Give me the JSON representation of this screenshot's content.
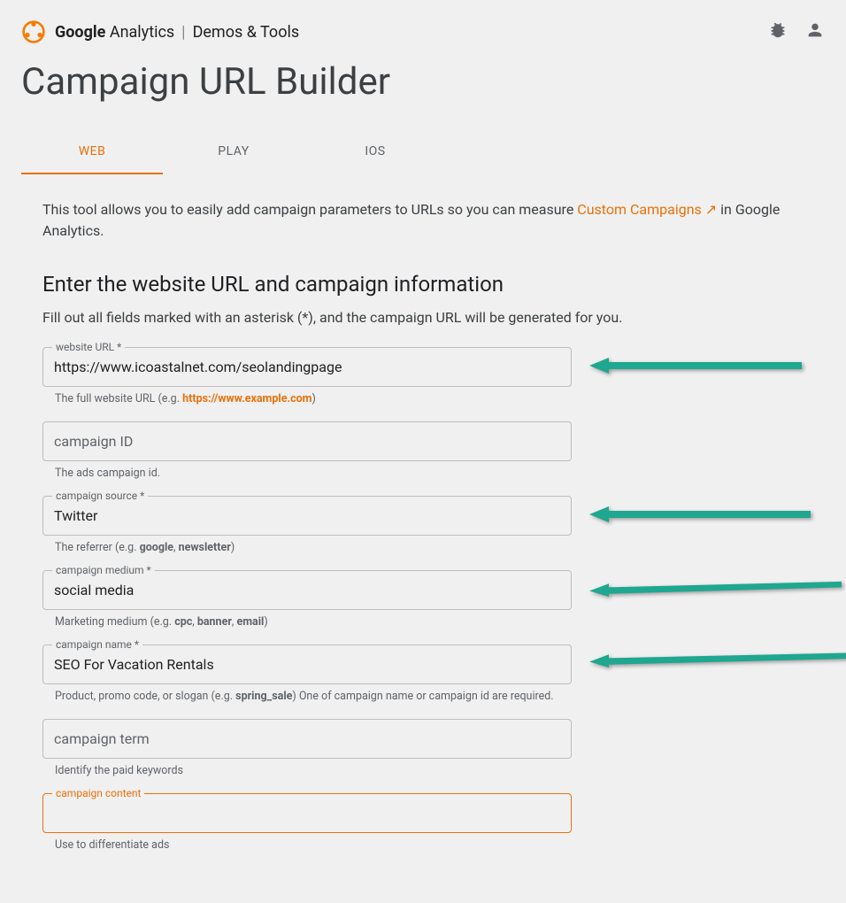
{
  "header": {
    "brand_bold": "Google",
    "brand_light": " Analytics",
    "divider": "|",
    "section": "Demos & Tools"
  },
  "page_title": "Campaign URL Builder",
  "tabs": {
    "web": "WEB",
    "play": "PLAY",
    "ios": "IOS"
  },
  "intro": {
    "part1": "This tool allows you to easily add campaign parameters to URLs so you can measure ",
    "link": "Custom Campaigns",
    "part2": " in Google Analytics."
  },
  "section_heading": "Enter the website URL and campaign information",
  "section_sub": "Fill out all fields marked with an asterisk (*), and the campaign URL will be generated for you.",
  "fields": {
    "website_url": {
      "label": "website URL *",
      "value": "https://www.icoastalnet.com/seolandingpage",
      "helper_pre": "The full website URL (e.g. ",
      "helper_link": "https://www.example.com",
      "helper_post": ")"
    },
    "campaign_id": {
      "placeholder": "campaign ID",
      "helper": "The ads campaign id."
    },
    "campaign_source": {
      "label": "campaign source *",
      "value": "Twitter",
      "helper_pre": "The referrer (e.g. ",
      "helper_b1": "google",
      "helper_mid": ", ",
      "helper_b2": "newsletter",
      "helper_post": ")"
    },
    "campaign_medium": {
      "label": "campaign medium *",
      "value": "social media",
      "helper_pre": "Marketing medium (e.g. ",
      "helper_b1": "cpc",
      "helper_m1": ", ",
      "helper_b2": "banner",
      "helper_m2": ", ",
      "helper_b3": "email",
      "helper_post": ")"
    },
    "campaign_name": {
      "label": "campaign name *",
      "value": "SEO For Vacation Rentals",
      "helper_pre": "Product, promo code, or slogan (e.g. ",
      "helper_b1": "spring_sale",
      "helper_post": ") One of campaign name or campaign id are required."
    },
    "campaign_term": {
      "placeholder": "campaign term",
      "helper": "Identify the paid keywords"
    },
    "campaign_content": {
      "label": "campaign content",
      "value": "",
      "helper": "Use to differentiate ads"
    }
  }
}
